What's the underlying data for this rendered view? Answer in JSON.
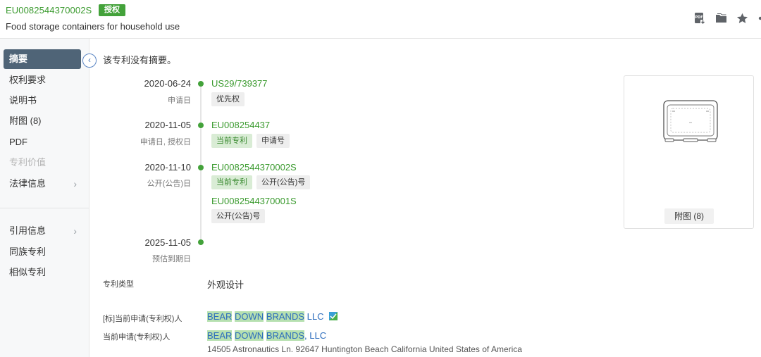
{
  "header": {
    "publication_number": "EU0082544370002S",
    "status_badge": "授权",
    "title": "Food storage containers for household use",
    "icons": [
      "pdf-download-icon",
      "folder-icon",
      "star-icon",
      "more-icon"
    ]
  },
  "sidebar": {
    "items": [
      {
        "label": "摘要",
        "active": true
      },
      {
        "label": "权利要求"
      },
      {
        "label": "说明书"
      },
      {
        "label": "附图 (8)"
      },
      {
        "label": "PDF"
      },
      {
        "label": "专利价值",
        "disabled": true
      },
      {
        "label": "法律信息",
        "has_chevron": true
      },
      {
        "label": "引用信息",
        "has_chevron": true
      },
      {
        "label": "同族专利"
      },
      {
        "label": "相似专利"
      }
    ],
    "chevron": "›",
    "collapse_glyph": "‹"
  },
  "abstract": {
    "empty_text": "该专利没有摘要。"
  },
  "timeline": {
    "events": [
      {
        "date": "2020-06-24",
        "label": "申请日",
        "link": "US29/739377",
        "tags": [
          "优先权"
        ]
      },
      {
        "date": "2020-11-05",
        "label": "申请日, 授权日",
        "link": "EU008254437",
        "tags": [
          "当前专利",
          "申请号"
        ]
      },
      {
        "date": "2020-11-10",
        "label": "公开(公告)日",
        "link": "EU0082544370002S",
        "tags": [
          "当前专利",
          "公开(公告)号"
        ],
        "extra_link": "EU0082544370001S",
        "extra_tags": [
          "公开(公告)号"
        ]
      },
      {
        "date": "2025-11-05",
        "label": "预估到期日"
      }
    ]
  },
  "drawings": {
    "button_label": "附图 (8)"
  },
  "fields": {
    "patent_type_label": "专利类型",
    "patent_type_value": "外观设计",
    "std_assignee_label": "[标]当前申请(专利权)人",
    "std_assignee_words": [
      "BEAR",
      "DOWN",
      "BRANDS"
    ],
    "std_assignee_suffix": "LLC",
    "assignee_label": "当前申请(专利权)人",
    "assignee_words": [
      "BEAR",
      "DOWN",
      "BRANDS"
    ],
    "assignee_suffix": ", LLC",
    "assignee_address": "14505 Astronautics Ln. 92647 Huntington Beach California United States of America"
  },
  "colors": {
    "accent_green": "#43a23a",
    "link_green": "#3a9a2e",
    "highlight": "#b6e0b0",
    "link_blue": "#2d6dbd",
    "active_nav": "#4f6477"
  }
}
